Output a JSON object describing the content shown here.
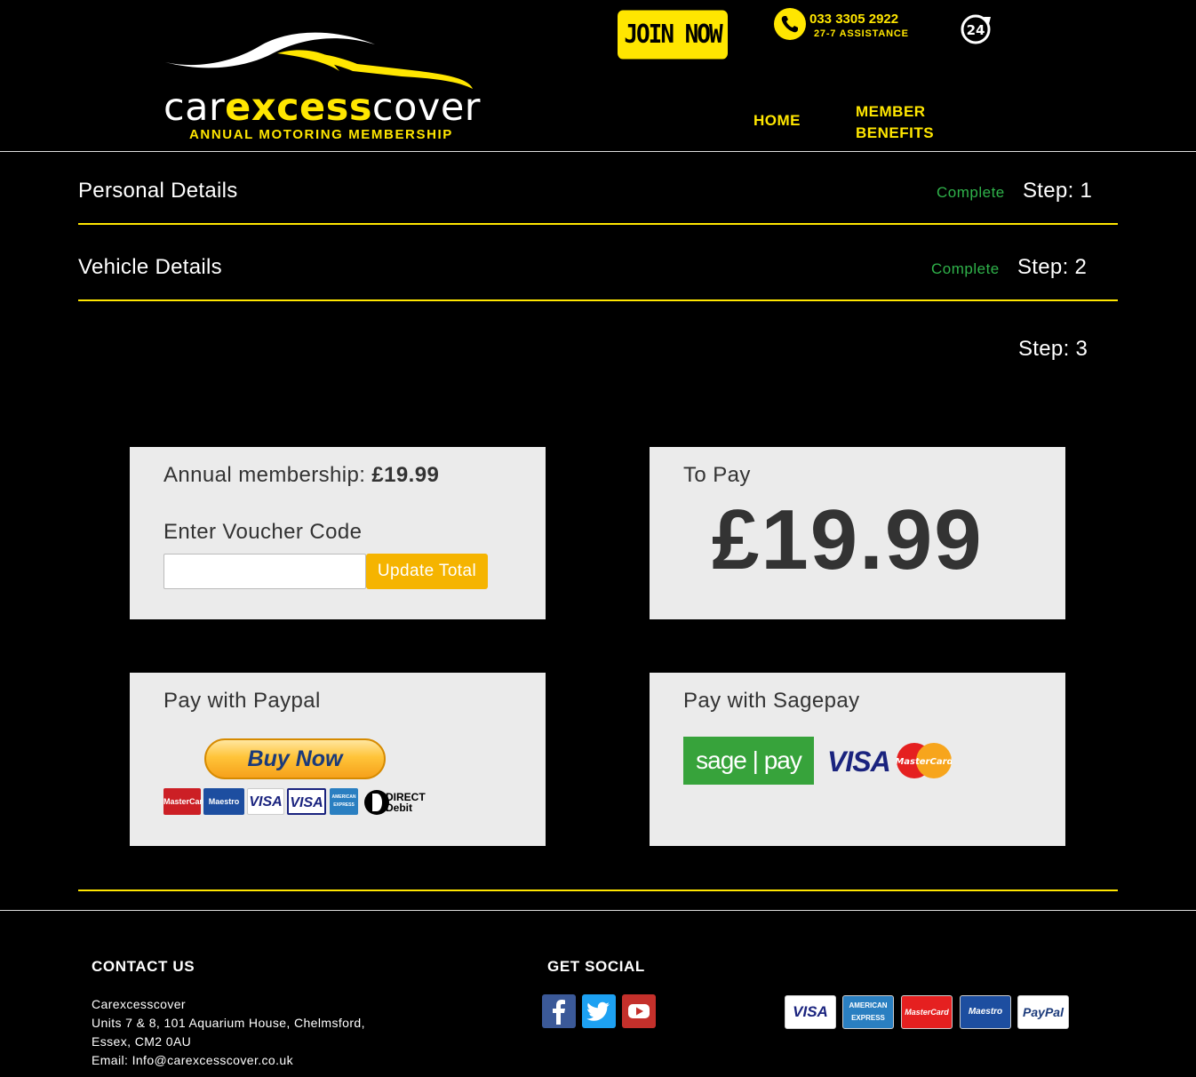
{
  "header": {
    "logo": {
      "word_left": "car",
      "word_mid": "excess",
      "word_right": "cover",
      "tagline": "ANNUAL MOTORING MEMBERSHIP"
    },
    "join_label": "JOIN NOW",
    "phone": {
      "number": "033 3305 2922",
      "subtitle": "27-7 ASSISTANCE",
      "icon": "phone-icon"
    },
    "badge_24": "24",
    "nav": {
      "home": "HOME",
      "benefits": "MEMBER BENEFITS"
    }
  },
  "steps": [
    {
      "title": "Personal Details",
      "status": "Complete",
      "step": "Step: 1"
    },
    {
      "title": "Vehicle Details",
      "status": "Complete",
      "step": "Step: 2"
    },
    {
      "title": "",
      "status": "",
      "step": "Step: 3"
    }
  ],
  "membership": {
    "label": "Annual membership: ",
    "price": "£19.99"
  },
  "voucher": {
    "label": "Enter Voucher Code",
    "value": "",
    "placeholder": "",
    "button": "Update Total"
  },
  "to_pay": {
    "label": "To Pay",
    "amount": "£19.99"
  },
  "paypal": {
    "label": "Pay with Paypal",
    "button": "Buy Now",
    "cards": [
      "MasterCard",
      "Maestro",
      "VISA",
      "VISA",
      "AMERICAN EXPRESS",
      "DIRECT Debit"
    ]
  },
  "sagepay": {
    "label": "Pay with Sagepay",
    "logo": "sage | pay",
    "visa": "VISA",
    "mastercard": "MasterCard"
  },
  "footer": {
    "contact_heading": "CONTACT US",
    "company": "Carexcesscover",
    "address1": "Units 7 & 8, 101 Aquarium House, Chelmsford,",
    "address2": "Essex, CM2 0AU",
    "email": "Email: Info@carexcesscover.co.uk",
    "social_heading": "GET SOCIAL",
    "social": [
      "facebook-icon",
      "twitter-icon",
      "youtube-icon"
    ],
    "payment_logos": [
      "VISA",
      "AMERICAN EXPRESS",
      "MasterCard",
      "Maestro",
      "PayPal"
    ]
  },
  "colors": {
    "brand_yellow": "#ffe600",
    "complete_green": "#2fb24a",
    "card_bg": "#ebebeb",
    "button_orange": "#f5b400"
  }
}
